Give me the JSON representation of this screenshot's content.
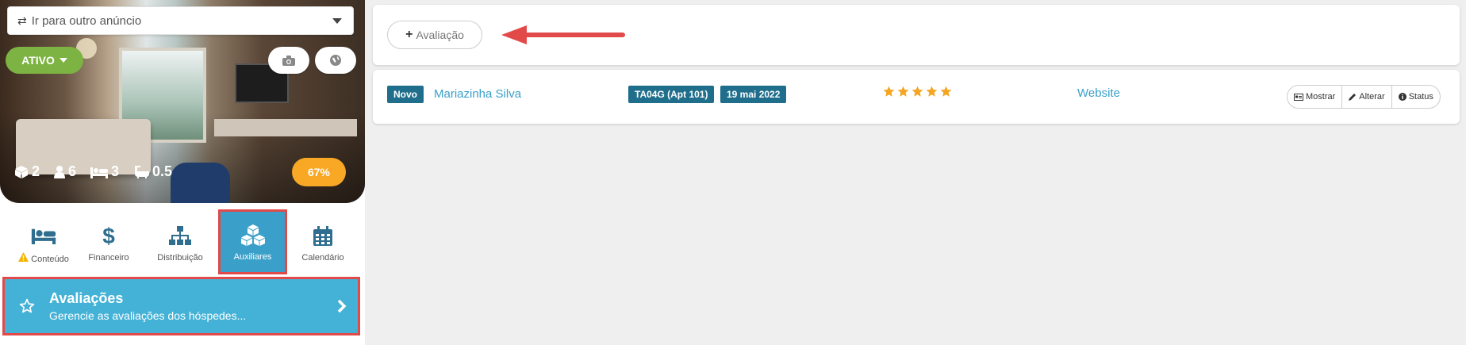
{
  "left": {
    "selector": {
      "label": "Ir para outro anúncio"
    },
    "status": {
      "label": "ATIVO",
      "color": "#7cb342"
    },
    "stats": {
      "rooms": "2",
      "guests": "6",
      "beds": "3",
      "baths": "0.5"
    },
    "completion": "67%",
    "nav": [
      {
        "label": "Conteúdo",
        "icon": "bed-icon",
        "warning": true
      },
      {
        "label": "Financeiro",
        "icon": "dollar-icon"
      },
      {
        "label": "Distribuição",
        "icon": "sitemap-icon"
      },
      {
        "label": "Auxiliares",
        "icon": "cubes-icon",
        "active": true
      },
      {
        "label": "Calendário",
        "icon": "calendar-icon"
      }
    ],
    "section_card": {
      "title": "Avaliações",
      "subtitle": "Gerencie as avaliações dos hóspedes..."
    }
  },
  "main": {
    "add_button": "Avaliação",
    "review": {
      "status": "Novo",
      "guest_name": "Mariazinha Silva",
      "unit": "TA04G (Apt 101)",
      "date": "19 mai 2022",
      "rating": 5,
      "source": "Website",
      "actions": [
        "Mostrar",
        "Alterar",
        "Status"
      ]
    }
  },
  "colors": {
    "accent": "#3aa0c9",
    "label_bg": "#1f6e8c",
    "star": "#f4a522",
    "highlight": "#e24a4a",
    "card_active": "#44b2d6"
  }
}
